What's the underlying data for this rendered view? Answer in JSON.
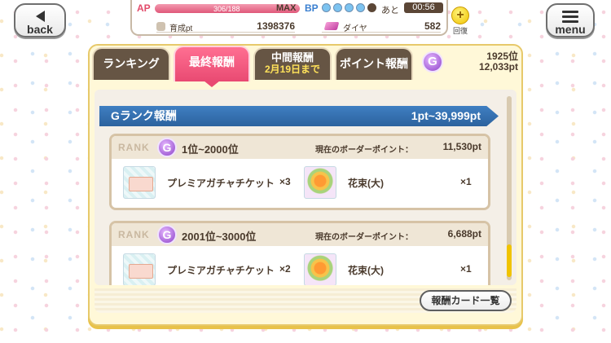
{
  "nav": {
    "back_label": "back",
    "menu_label": "menu"
  },
  "status": {
    "ap_label": "AP",
    "ap_value": "306/188",
    "ap_max": "MAX",
    "ap_fill": 1.0,
    "bp_label": "BP",
    "bp_filled": 4,
    "bp_total": 5,
    "bp_ato": "あと",
    "bp_timer": "00:56",
    "pt_label": "育成pt",
    "pt_value": "1398376",
    "diamond_label": "ダイヤ",
    "diamond_value": "582"
  },
  "recover": {
    "label": "回復"
  },
  "tabs": [
    {
      "label": "ランキング"
    },
    {
      "label": "最終報酬",
      "active": true
    },
    {
      "label": "中間報酬",
      "sub": "2月19日まで"
    },
    {
      "label": "ポイント報酬"
    }
  ],
  "my_rank": {
    "badge": "G",
    "position": "1925位",
    "points": "12,033pt"
  },
  "group": {
    "title": "Gランク報酬",
    "range": "1pt~39,999pt"
  },
  "rewards": [
    {
      "rank_tag": "RANK",
      "badge": "G",
      "range": "1位~2000位",
      "border_label": "現在のボーダーポイント：",
      "border_value": "11,530pt",
      "items": [
        {
          "name": "プレミアガチャチケット",
          "qty": "×3"
        },
        {
          "name": "花束(大)",
          "qty": "×1"
        }
      ]
    },
    {
      "rank_tag": "RANK",
      "badge": "G",
      "range": "2001位~3000位",
      "border_label": "現在のボーダーポイント：",
      "border_value": "6,688pt",
      "items": [
        {
          "name": "プレミアガチャチケット",
          "qty": "×2"
        },
        {
          "name": "花束(大)",
          "qty": "×1"
        }
      ]
    }
  ],
  "buttons": {
    "card_list": "報酬カード一覧"
  },
  "colors": {
    "accent_pink": "#e94a72",
    "header_blue": "#2c629e",
    "gold": "#f0c300"
  }
}
